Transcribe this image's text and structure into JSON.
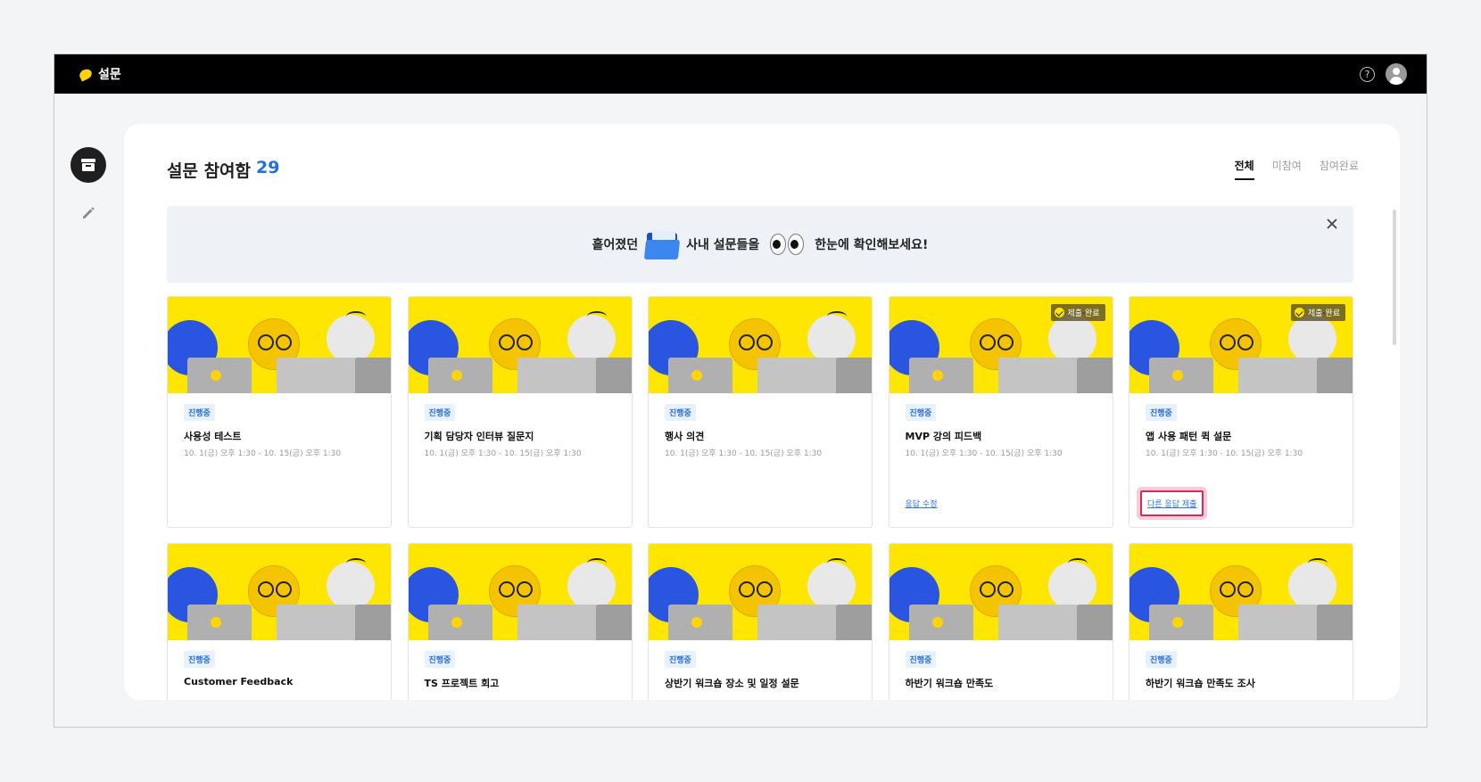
{
  "app": {
    "title": "설문"
  },
  "header": {
    "help_icon": "question-circle-icon",
    "avatar_icon": "user-avatar-icon"
  },
  "sidebar": {
    "items": [
      {
        "icon": "archive-box-icon",
        "active": true
      },
      {
        "icon": "pencil-icon",
        "active": false
      }
    ]
  },
  "main": {
    "title": "설문 참여함",
    "count": "29",
    "tabs": [
      {
        "label": "전체",
        "active": true
      },
      {
        "label": "미참여",
        "active": false
      },
      {
        "label": "참여완료",
        "active": false
      }
    ]
  },
  "banner": {
    "text1": "흩어졌던",
    "text2": "사내 설문들을",
    "text3": "한눈에 확인해보세요!"
  },
  "status_done_label": "제출 완료",
  "surveys": [
    {
      "status": "진행중",
      "title": "사용성 테스트",
      "date": "10. 1(금) 오후 1:30 - 10. 15(금) 오후 1:30",
      "submitted": false,
      "link": ""
    },
    {
      "status": "진행중",
      "title": "기획 담당자 인터뷰 질문지",
      "date": "10. 1(금) 오후 1:30 - 10. 15(금) 오후 1:30",
      "submitted": false,
      "link": ""
    },
    {
      "status": "진행중",
      "title": "행사 의견",
      "date": "10. 1(금) 오후 1:30 - 10. 15(금) 오후 1:30",
      "submitted": false,
      "link": ""
    },
    {
      "status": "진행중",
      "title": "MVP 강의 피드백",
      "date": "10. 1(금) 오후 1:30 - 10. 15(금) 오후 1:30",
      "submitted": true,
      "link": "응답 수정"
    },
    {
      "status": "진행중",
      "title": "앱 사용 패턴 퀵 설문",
      "date": "10. 1(금) 오후 1:30 - 10. 15(금) 오후 1:30",
      "submitted": true,
      "link": "다른 응답 제출"
    },
    {
      "status": "진행중",
      "title": "Customer Feedback",
      "date": "",
      "submitted": false,
      "link": ""
    },
    {
      "status": "진행중",
      "title": "TS 프로젝트 회고",
      "date": "",
      "submitted": false,
      "link": ""
    },
    {
      "status": "진행중",
      "title": "상반기 워크숍 장소 및 일정 설문",
      "date": "",
      "submitted": false,
      "link": ""
    },
    {
      "status": "진행중",
      "title": "하반기 워크숍 만족도",
      "date": "",
      "submitted": false,
      "link": ""
    },
    {
      "status": "진행중",
      "title": "하반기 워크숍 만족도 조사",
      "date": "",
      "submitted": false,
      "link": ""
    }
  ],
  "colors": {
    "accent": "#2271e0",
    "thumb_bg": "#ffe600",
    "highlight": "#d22b5c",
    "topbar": "#000000"
  }
}
